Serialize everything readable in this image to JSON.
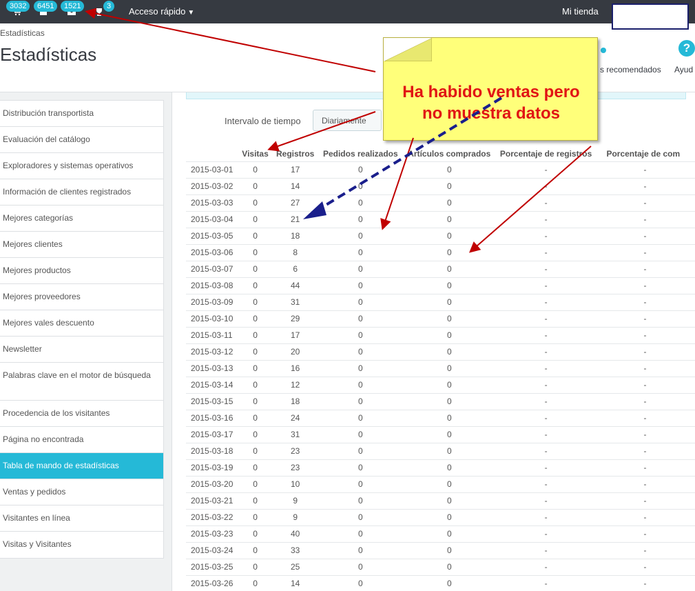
{
  "topbar": {
    "badges": [
      "3032",
      "6451",
      "1521",
      "3"
    ],
    "quick_access": "Acceso rápido",
    "shop_name": "Mi tienda"
  },
  "header": {
    "breadcrumb": "Estadísticas",
    "title": "Estadísticas",
    "recommended": "s recomendados",
    "help": "Ayud"
  },
  "sidebar": {
    "items": [
      "Distribución transportista",
      "Evaluación del catálogo",
      "Exploradores y sistemas operativos",
      "Información de clientes registrados",
      "Mejores categorías",
      "Mejores clientes",
      "Mejores productos",
      "Mejores proveedores",
      "Mejores vales descuento",
      "Newsletter",
      "Palabras clave en el motor de búsqueda",
      "Procedencia de los visitantes",
      "Página no encontrada",
      "Tabla de mando de estadísticas",
      "Ventas y pedidos",
      "Visitantes en línea",
      "Visitas y Visitantes"
    ],
    "active_index": 13
  },
  "filter": {
    "interval_label": "Intervalo de tiempo",
    "interval_value": "Diariamente"
  },
  "table": {
    "headers": [
      "",
      "Visitas",
      "Registros",
      "Pedidos realizados",
      "Artículos comprados",
      "Porcentaje de registros",
      "Porcentaje de com"
    ],
    "rows": [
      [
        "2015-03-01",
        "0",
        "17",
        "0",
        "0",
        "-",
        "-"
      ],
      [
        "2015-03-02",
        "0",
        "14",
        "0",
        "0",
        "-",
        "-"
      ],
      [
        "2015-03-03",
        "0",
        "27",
        "0",
        "0",
        "-",
        "-"
      ],
      [
        "2015-03-04",
        "0",
        "21",
        "0",
        "0",
        "-",
        "-"
      ],
      [
        "2015-03-05",
        "0",
        "18",
        "0",
        "0",
        "-",
        "-"
      ],
      [
        "2015-03-06",
        "0",
        "8",
        "0",
        "0",
        "-",
        "-"
      ],
      [
        "2015-03-07",
        "0",
        "6",
        "0",
        "0",
        "-",
        "-"
      ],
      [
        "2015-03-08",
        "0",
        "44",
        "0",
        "0",
        "-",
        "-"
      ],
      [
        "2015-03-09",
        "0",
        "31",
        "0",
        "0",
        "-",
        "-"
      ],
      [
        "2015-03-10",
        "0",
        "29",
        "0",
        "0",
        "-",
        "-"
      ],
      [
        "2015-03-11",
        "0",
        "17",
        "0",
        "0",
        "-",
        "-"
      ],
      [
        "2015-03-12",
        "0",
        "20",
        "0",
        "0",
        "-",
        "-"
      ],
      [
        "2015-03-13",
        "0",
        "16",
        "0",
        "0",
        "-",
        "-"
      ],
      [
        "2015-03-14",
        "0",
        "12",
        "0",
        "0",
        "-",
        "-"
      ],
      [
        "2015-03-15",
        "0",
        "18",
        "0",
        "0",
        "-",
        "-"
      ],
      [
        "2015-03-16",
        "0",
        "24",
        "0",
        "0",
        "-",
        "-"
      ],
      [
        "2015-03-17",
        "0",
        "31",
        "0",
        "0",
        "-",
        "-"
      ],
      [
        "2015-03-18",
        "0",
        "23",
        "0",
        "0",
        "-",
        "-"
      ],
      [
        "2015-03-19",
        "0",
        "23",
        "0",
        "0",
        "-",
        "-"
      ],
      [
        "2015-03-20",
        "0",
        "10",
        "0",
        "0",
        "-",
        "-"
      ],
      [
        "2015-03-21",
        "0",
        "9",
        "0",
        "0",
        "-",
        "-"
      ],
      [
        "2015-03-22",
        "0",
        "9",
        "0",
        "0",
        "-",
        "-"
      ],
      [
        "2015-03-23",
        "0",
        "40",
        "0",
        "0",
        "-",
        "-"
      ],
      [
        "2015-03-24",
        "0",
        "33",
        "0",
        "0",
        "-",
        "-"
      ],
      [
        "2015-03-25",
        "0",
        "25",
        "0",
        "0",
        "-",
        "-"
      ],
      [
        "2015-03-26",
        "0",
        "14",
        "0",
        "0",
        "-",
        "-"
      ]
    ]
  },
  "annotation": {
    "note_line1": "Ha habido ventas pero",
    "note_line2": "no muestra datos"
  },
  "colors": {
    "topbar": "#363a41",
    "accent": "#25b9d7",
    "note_bg": "#ffff7a",
    "note_text": "#e11414",
    "arrow_red": "#c00000",
    "arrow_blue": "#1a1f8c"
  }
}
